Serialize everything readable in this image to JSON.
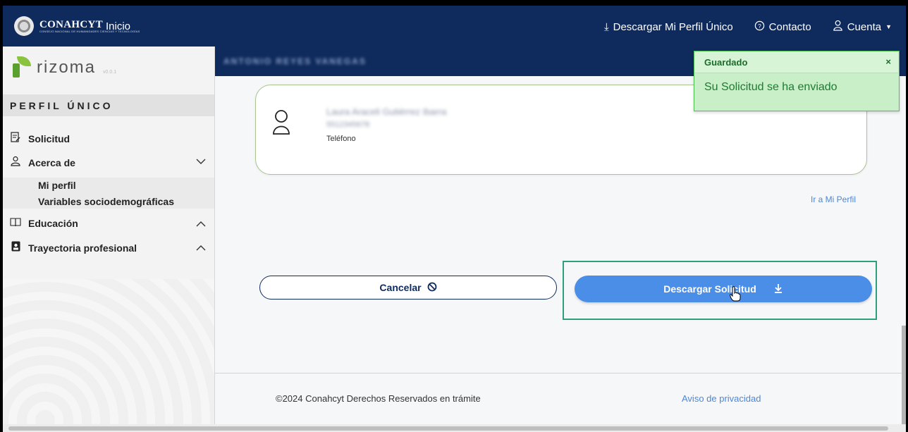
{
  "topbar": {
    "brand": "CONAHCYT",
    "brand_sub": "CONSEJO NACIONAL DE HUMANIDADES CIENCIAS Y TECNOLOGÍAS",
    "inicio": "Inicio",
    "download_profile": "Descargar Mi Perfil Único",
    "contact": "Contacto",
    "account": "Cuenta"
  },
  "sidebar": {
    "app_name": "rizoma",
    "app_version": "v0.0.1",
    "section_title": "PERFIL ÚNICO",
    "items": [
      {
        "label": "Solicitud",
        "icon": "document-edit-icon"
      },
      {
        "label": "Acerca de",
        "icon": "user-icon"
      },
      {
        "label": "Educación",
        "icon": "book-icon"
      },
      {
        "label": "Trayectoria profesional",
        "icon": "badge-icon"
      }
    ],
    "sub_items": [
      "Mi perfil",
      "Variables sociodemográficas"
    ]
  },
  "main": {
    "banner_name": "ANTONIO REYES VANEGAS",
    "card": {
      "contact_name": "Laura Araceli Gutiérrez Ibarra",
      "contact_phone": "5512345678",
      "phone_label": "Teléfono"
    },
    "ir_perfil": "Ir a Mi Perfil",
    "cancel_label": "Cancelar",
    "download_label": "Descargar Solicitud"
  },
  "footer": {
    "copyright": "©2024 Conahcyt Derechos Reservados en trámite",
    "privacy": "Aviso de privacidad"
  },
  "toast": {
    "title": "Guardado",
    "close": "×",
    "message": "Su Solicitud se ha enviado"
  },
  "colors": {
    "navy": "#0f2a5c",
    "accent_blue": "#4a8ee8",
    "success_green": "#4fbf4f"
  }
}
